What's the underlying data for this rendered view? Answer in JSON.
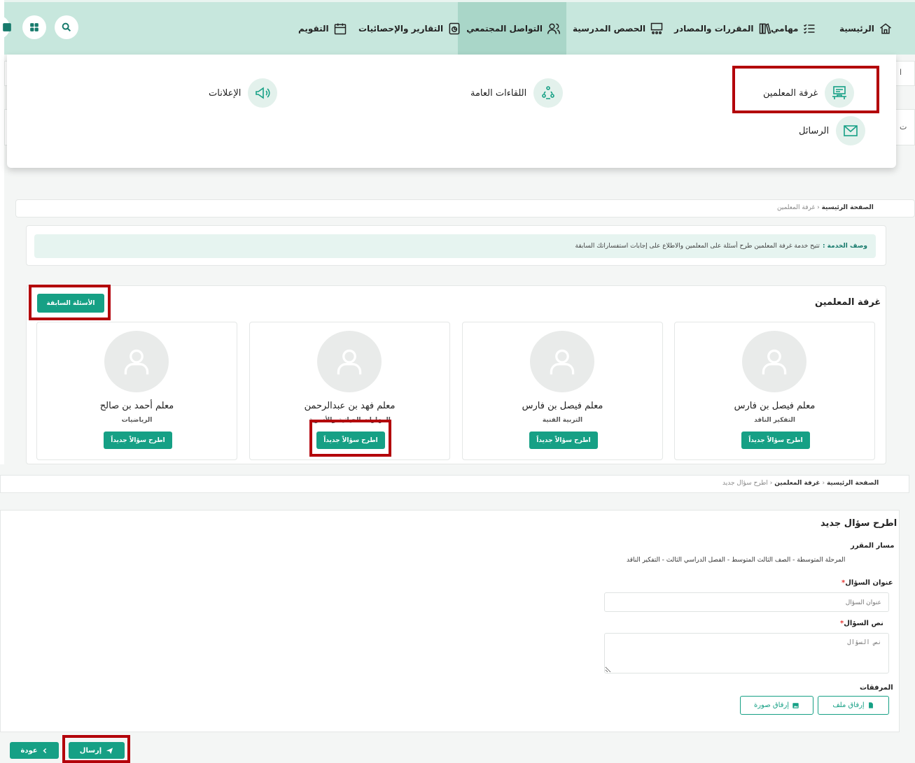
{
  "nav": {
    "home": "الرئيسية",
    "tasks": "مهامي",
    "courses": "المقررات والمصادر",
    "classes": "الحصص المدرسية",
    "social": "التواصل المجتمعي",
    "reports": "التقارير والإحصائيات",
    "calendar": "التقويم"
  },
  "dropdown": {
    "teachers_room": "غرفة المعلمين",
    "public_meetings": "اللقاءات العامة",
    "announcements": "الإعلانات",
    "messages": "الرسائل"
  },
  "edge_clips": {
    "left1": "ا",
    "left2": "ت"
  },
  "page1": {
    "breadcrumb": {
      "home": "الصفحة الرئيسية",
      "sep": "‹",
      "current": "غرفة المعلمين"
    },
    "description": {
      "label": "وصف الخدمة :",
      "text": "تتيح خدمة غرفة المعلمين طرح أسئلة على المعلمين والاطلاع على إجابات استفساراتك السابقة"
    },
    "room_title": "غرفة المعلمين",
    "previous_questions": "الأسئلة السابقة",
    "ask_button": "اطرح سؤالاً جديداً",
    "teachers": [
      {
        "name": "معلم فيصل بن فارس",
        "subject": "التفكير الناقد"
      },
      {
        "name": "معلم فيصل بن فارس",
        "subject": "التربية الفنية"
      },
      {
        "name": "معلم فهد بن عبدالرحمن",
        "subject": "المهارات الحياتية والأسرية"
      },
      {
        "name": "معلم أحمد بن صالح",
        "subject": "الرياضيات"
      }
    ]
  },
  "page2": {
    "breadcrumb": {
      "home": "الصفحة الرئيسية",
      "sep": "‹",
      "middle": "غرفة المعلمين",
      "current": "اطرح سؤال جديد"
    },
    "title": "اطرح سؤال جديد",
    "path_label": "مسار المقرر",
    "path_value": "المرحلة المتوسطة - الصف الثالث المتوسط - الفصل الدراسي الثالث - التفكير الناقد",
    "q_title_label": "عنوان السؤال",
    "q_title_placeholder": "عنوان السؤال",
    "q_text_label": "نص السؤال",
    "q_text_placeholder": "نص السؤال",
    "required_mark": "*",
    "attachments_label": "المرفقات",
    "attach_file": "إرفاق ملف",
    "attach_image": "إرفاق صورة",
    "send": "إرسال",
    "back": "عودة"
  },
  "colors": {
    "primary": "#16a085",
    "nav_bg": "#c7e7dd",
    "highlight": "#b3000a"
  }
}
